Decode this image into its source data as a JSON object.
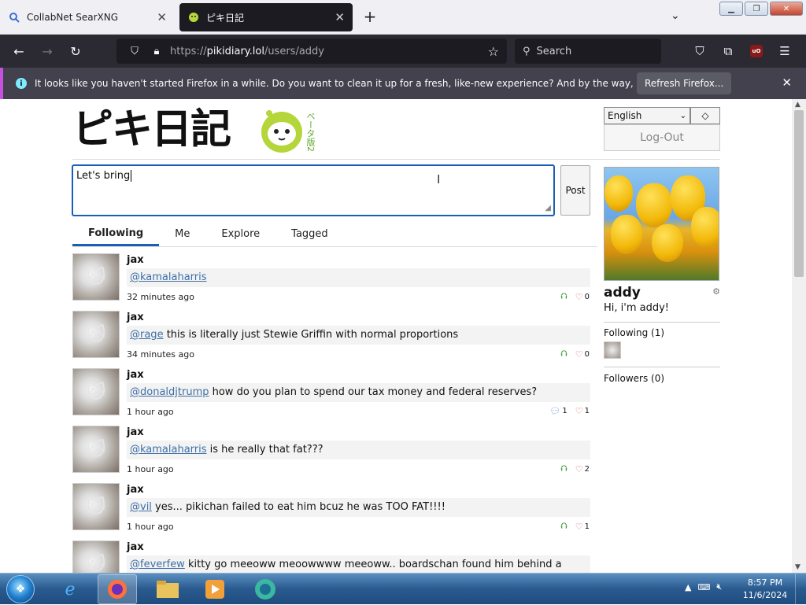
{
  "browser": {
    "tabs": [
      {
        "title": "CollabNet SearXNG",
        "active": false
      },
      {
        "title": "ピキ日記",
        "active": true
      }
    ],
    "url_prefix": "https://",
    "url_host": "pikidiary.lol",
    "url_path": "/users/addy",
    "search_placeholder": "Search"
  },
  "notification": {
    "message": "It looks like you haven't started Firefox in a while. Do you want to clean it up for a fresh, like-new experience? And by the way, welcome back!",
    "button": "Refresh Firefox..."
  },
  "site": {
    "logo_text": "ピキ日記",
    "logo_sub": "ベータ版2",
    "language": "English",
    "diamond": "◇",
    "logout": "Log-Out",
    "compose_value": "Let's bring",
    "post_button": "Post",
    "tabs": [
      "Following",
      "Me",
      "Explore",
      "Tagged"
    ],
    "active_tab": "Following"
  },
  "posts": [
    {
      "author": "jax",
      "mention": "@kamalaharris",
      "text": "",
      "time": "32 minutes ago",
      "action1": "reply",
      "count1": "",
      "likes": "0"
    },
    {
      "author": "jax",
      "mention": "@rage",
      "text": " this is literally just Stewie Griffin with normal proportions",
      "time": "34 minutes ago",
      "action1": "reply",
      "count1": "",
      "likes": "0"
    },
    {
      "author": "jax",
      "mention": "@donaldjtrump",
      "text": " how do you plan to spend our tax money and federal reserves?",
      "time": "1 hour ago",
      "action1": "comment",
      "count1": "1",
      "likes": "1"
    },
    {
      "author": "jax",
      "mention": "@kamalaharris",
      "text": " is he really that fat???",
      "time": "1 hour ago",
      "action1": "reply",
      "count1": "",
      "likes": "2"
    },
    {
      "author": "jax",
      "mention": "@vil",
      "text": " yes... pikichan failed to eat him bcuz he was TOO FAT!!!!",
      "time": "1 hour ago",
      "action1": "reply",
      "count1": "",
      "likes": "1"
    },
    {
      "author": "jax",
      "mention": "@feverfew",
      "text": " kitty go meeoww meoowwww meeoww.. boardschan found him behind a",
      "time": "",
      "action1": "",
      "count1": "",
      "likes": ""
    }
  ],
  "profile": {
    "username": "addy",
    "bio": "Hi, i'm addy!",
    "following_label": "Following (1)",
    "followers_label": "Followers (0)"
  },
  "taskbar": {
    "time": "8:57 PM",
    "date": "11/6/2024"
  }
}
